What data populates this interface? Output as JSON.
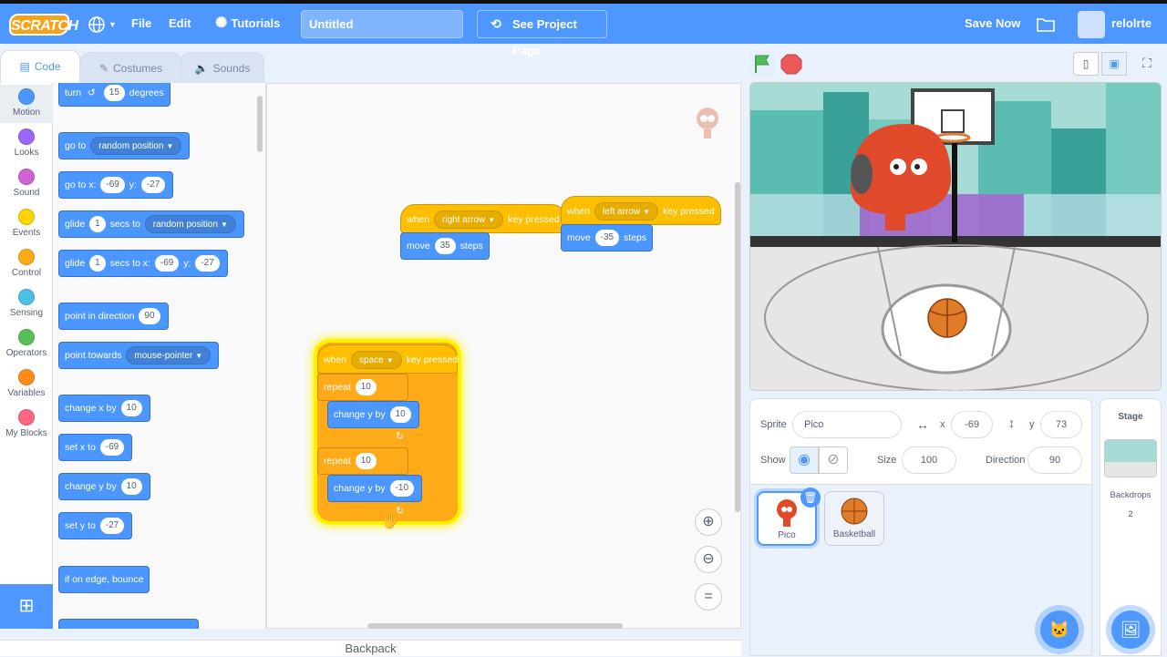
{
  "menubar": {
    "logo": "SCRATCH",
    "file": "File",
    "edit": "Edit",
    "tutorials": "Tutorials",
    "project_title": "Untitled",
    "see_project": "See Project Page",
    "save_now": "Save Now",
    "username": "relolrte"
  },
  "tabs": {
    "code": "Code",
    "costumes": "Costumes",
    "sounds": "Sounds"
  },
  "categories": [
    {
      "label": "Motion",
      "color": "#4c97ff"
    },
    {
      "label": "Looks",
      "color": "#9966ff"
    },
    {
      "label": "Sound",
      "color": "#cf63cf"
    },
    {
      "label": "Events",
      "color": "#ffd500"
    },
    {
      "label": "Control",
      "color": "#ffab19"
    },
    {
      "label": "Sensing",
      "color": "#4cbfe6"
    },
    {
      "label": "Operators",
      "color": "#59c059"
    },
    {
      "label": "Variables",
      "color": "#ff8c1a"
    },
    {
      "label": "My Blocks",
      "color": "#ff6680"
    }
  ],
  "palette": {
    "turn": "turn",
    "turn_val": "15",
    "degrees": "degrees",
    "goto": "go to",
    "goto_dd": "random position",
    "gotoxy": "go to x:",
    "gotoxy_x": "-69",
    "y_label": "y:",
    "gotoxy_y": "-27",
    "glide": "glide",
    "glide_val": "1",
    "secs_to": "secs to",
    "glide_dd": "random position",
    "glide2_val": "1",
    "secs_to_x": "secs to x:",
    "glide2_x": "-69",
    "glide2_y": "-27",
    "point_dir": "point in direction",
    "point_dir_val": "90",
    "point_towards": "point towards",
    "point_towards_dd": "mouse-pointer",
    "change_x": "change x by",
    "change_x_val": "10",
    "set_x": "set x to",
    "set_x_val": "-69",
    "change_y": "change y by",
    "change_y_val": "10",
    "set_y": "set y to",
    "set_y_val": "-27",
    "bounce": "if on edge, bounce"
  },
  "scripts": {
    "when": "when",
    "key_pressed": "key pressed",
    "right_key": "right arrow",
    "move": "move",
    "right_steps": "35",
    "steps": "steps",
    "left_key": "left arrow",
    "left_steps": "-35",
    "space_key": "space",
    "repeat": "repeat",
    "repeat1": "10",
    "change_y_by": "change y by",
    "cy1": "10",
    "repeat2": "10",
    "cy2": "-10"
  },
  "backpack": "Backpack",
  "sprite_info": {
    "sprite_label": "Sprite",
    "sprite_name": "Pico",
    "x_label": "x",
    "x": "-69",
    "y_label": "y",
    "y": "73",
    "show_label": "Show",
    "size_label": "Size",
    "size": "100",
    "direction_label": "Direction",
    "direction": "90"
  },
  "sprites": [
    {
      "name": "Pico"
    },
    {
      "name": "Basketball"
    }
  ],
  "stage_pane": {
    "title": "Stage",
    "backdrops_label": "Backdrops",
    "backdrops_count": "2"
  }
}
